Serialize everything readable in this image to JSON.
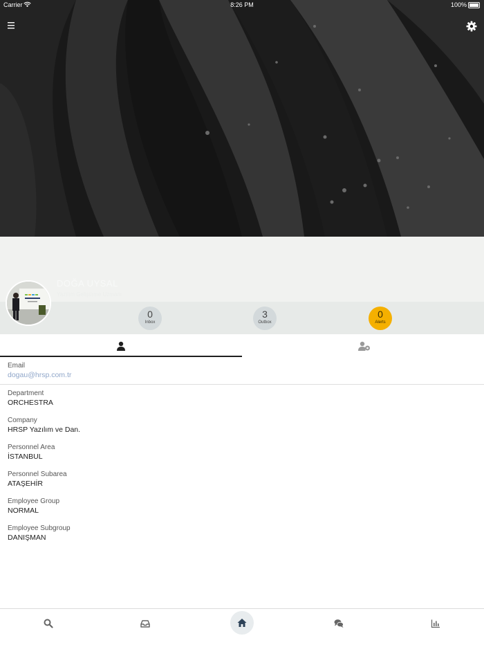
{
  "status_bar": {
    "carrier": "Carrier",
    "time": "8:26 PM",
    "battery": "100%"
  },
  "profile": {
    "name": "DOĞA UYSAL",
    "subtitle": "Yazılım Geliştirme Uzmanı"
  },
  "counters": [
    {
      "value": "0",
      "label": "Inbox"
    },
    {
      "value": "3",
      "label": "Outbox"
    },
    {
      "value": "0",
      "label": "Alerts"
    }
  ],
  "colors": {
    "alerts_accent": "#f5b000",
    "link": "#8fa6c9",
    "active_tab": "#1f1f1f"
  },
  "tabs": {
    "left_icon": "person-icon",
    "right_icon": "person-settings-icon"
  },
  "fields": [
    {
      "label": "Email",
      "value": "dogau@hrsp.com.tr"
    },
    {
      "label": "Department",
      "value": "ORCHESTRA"
    },
    {
      "label": "Company",
      "value": "HRSP Yazılım ve Dan."
    },
    {
      "label": "Personnel Area",
      "value": "İSTANBUL"
    },
    {
      "label": "Personnel Subarea",
      "value": "ATAŞEHİR"
    },
    {
      "label": "Employee Group",
      "value": "NORMAL"
    },
    {
      "label": "Employee Subgroup",
      "value": "DANIŞMAN"
    }
  ],
  "bottom_nav": [
    "search-icon",
    "inbox-icon",
    "home-icon",
    "chat-icon",
    "chart-icon"
  ]
}
